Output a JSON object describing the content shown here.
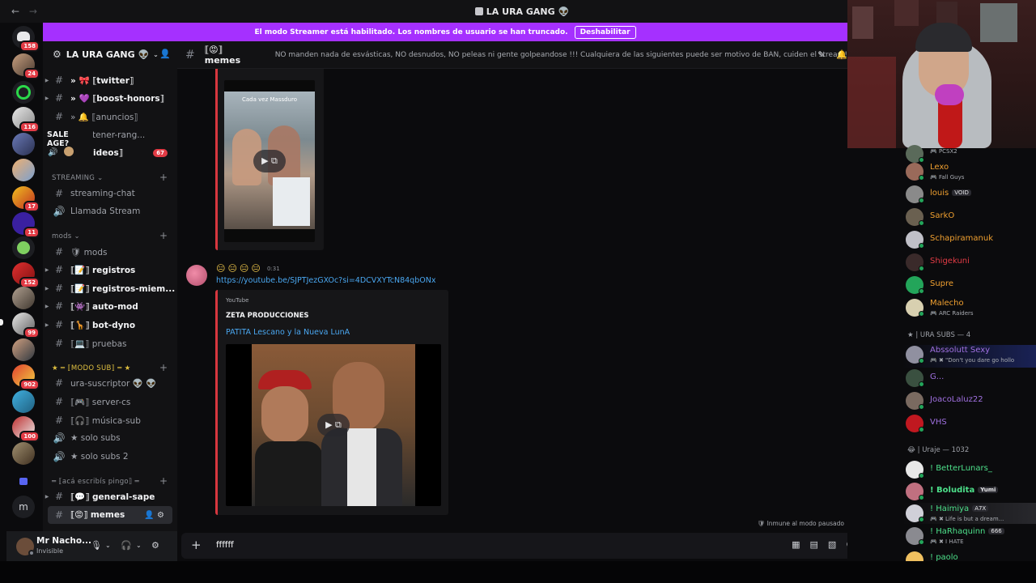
{
  "window": {
    "title": "LA URA GANG 👽"
  },
  "banner": {
    "message": "El modo Streamer está habilitado. Los nombres de usuario se han truncado.",
    "button": "Deshabilitar"
  },
  "server_rail": {
    "badges": [
      "158",
      "24",
      "116",
      "17",
      "11",
      "152",
      "99",
      "902",
      "100"
    ],
    "letter": "m"
  },
  "guild": {
    "name": "LA URA GANG 👽"
  },
  "tooltip": {
    "title": "SALE AGE?"
  },
  "channels": [
    {
      "name": "⟦twitter⟧",
      "prefix": "» 🎀 "
    },
    {
      "name": "⟦boost-honors⟧",
      "prefix": "» 💜 "
    },
    {
      "name": "⟦anuncios⟧",
      "prefix": "» 🔔 "
    },
    {
      "name": "omo-tener-rang...",
      "prefix": ""
    },
    {
      "name": "ew-videos⟧",
      "prefix": "",
      "unread": "67"
    }
  ],
  "categories": {
    "streaming": "STREAMING ⌄",
    "mods": "mods ⌄",
    "modo_sub": "★ ═ ⟦MODO SUB⟧ ═ ★",
    "aca": "═ ⟦acá escribís pingo⟧ ═"
  },
  "streaming_channels": [
    "streaming-chat",
    "Llamada Stream"
  ],
  "mods_channels": [
    "🛡 mods",
    "⟦📝⟧ registros",
    "⟦📝⟧ registros-miem...",
    "⟦👾⟧ auto-mod",
    "⟦🦒⟧ bot-dyno",
    "⟦💻⟧ pruebas"
  ],
  "sub_channels": [
    "ura-suscriptor 👽 👽",
    "⟦🎮⟧ server-cs",
    "⟦🎧⟧ música-sub",
    "★ solo subs",
    "★ solo subs 2"
  ],
  "chat_channels": [
    "⟦💬⟧ general-sape",
    "⟦😡⟧ memes"
  ],
  "user": {
    "name": "Mr Nacho...",
    "status": "Invisible"
  },
  "header": {
    "channel": "⟦😡⟧ memes",
    "topic": "NO manden nada de esvásticas, NO desnudos, NO peleas ni gente golpeandose !!! Cualquiera de las siguientes puede ser motivo de BAN, cuiden el stream!"
  },
  "messages": {
    "video1_caption": "Cada vez Massduro",
    "msg2_emoji": "😑😑😑😑",
    "msg2_time": "0:31",
    "msg2_link": "https://youtube.be/SJPTJezGXOc?si=4DCVXYTcN84qbONx",
    "embed_provider": "YouTube",
    "embed_author": "ZETA PRODUCCIONES",
    "embed_title": "PATITA Lescano y la Nueva LunA",
    "paused_note": "Inmune al modo pausado"
  },
  "composer": {
    "value": "ffffff"
  },
  "members": {
    "rows": [
      {
        "name": "",
        "sub": "🎮 PCSX2",
        "color": "#23a55a"
      },
      {
        "name": "Lexo",
        "sub": "🎮 Fall Guys",
        "color": "#f0a030"
      },
      {
        "name": "louis",
        "tag": "VOID",
        "color": "#f0a030"
      },
      {
        "name": "SarkO",
        "color": "#f0a030"
      },
      {
        "name": "Schapiramanuk",
        "color": "#f0a030"
      },
      {
        "name": "Shigekuni",
        "color": "#e23b45"
      },
      {
        "name": "Supre",
        "color": "#f0a030"
      },
      {
        "name": "Malecho",
        "sub": "🎮 ARC Raiders",
        "color": "#f0a030"
      }
    ],
    "cat_subs": "★ | URA SUBS — 4",
    "subs": [
      {
        "name": "Abssolutt Sexy",
        "sub": "🎮 ✖ \"Don't you dare go hollo",
        "color": "#a070e0"
      },
      {
        "name": "G...",
        "color": "#a070e0"
      },
      {
        "name": "JoacoLaluz22",
        "color": "#a070e0"
      },
      {
        "name": "VHS",
        "color": "#a070e0"
      }
    ],
    "cat_uraje": "😂 | Uraje — 1032",
    "uraje": [
      {
        "name": "! BetterLunars_",
        "color": "#4de08a"
      },
      {
        "name": "! Boludita",
        "tag": "Yumi",
        "color": "#4de08a"
      },
      {
        "name": "! Haimiya",
        "tag": "A7X",
        "sub": "🎮 ✖ Life is but a dream...",
        "color": "#4de08a"
      },
      {
        "name": "! HaRhaquinn",
        "tag": "666",
        "sub": "🎮 ✖ I HATE",
        "color": "#4de08a"
      },
      {
        "name": "! paolo",
        "color": "#4de08a"
      }
    ]
  }
}
